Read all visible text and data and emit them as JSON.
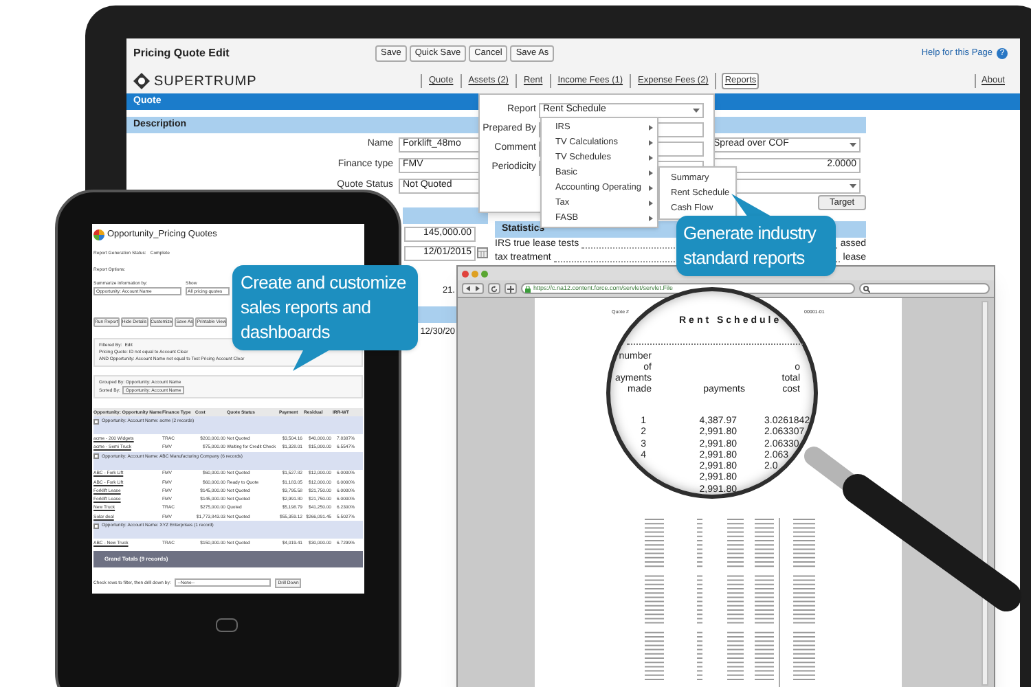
{
  "monitor": {
    "page_title": "Pricing Quote Edit",
    "toolbar_buttons": [
      "Save",
      "Quick Save",
      "Cancel",
      "Save As"
    ],
    "help_link": "Help for this Page",
    "help_icon": "?",
    "logo": "SUPERTRUMP",
    "nav_links": [
      {
        "label": "Quote",
        "selected": false
      },
      {
        "label": "Assets (2)",
        "selected": false
      },
      {
        "label": "Rent",
        "selected": false
      },
      {
        "label": "Income Fees (1)",
        "selected": false
      },
      {
        "label": "Expense Fees (2)",
        "selected": false
      },
      {
        "label": "Reports",
        "selected": true
      }
    ],
    "about_link": "About",
    "section_bar": "Quote",
    "description_bar": "Description",
    "form_fields": [
      {
        "label": "Name",
        "value": "Forklift_48mo"
      },
      {
        "label": "Finance type",
        "value": "FMV"
      },
      {
        "label": "Quote Status",
        "value": "Not Quoted"
      }
    ],
    "right_fields": [
      {
        "kind": "select",
        "value": "Spread over COF"
      },
      {
        "kind": "text",
        "value": "2.0000"
      },
      {
        "kind": "select"
      }
    ],
    "target_button": "Target",
    "lower_fields": [
      {
        "kind": "text",
        "value": "145,000.00"
      },
      {
        "kind": "date",
        "value": "12/01/2015"
      },
      {
        "kind": "gap"
      },
      {
        "kind": "partial",
        "value": "21."
      },
      {
        "kind": "section"
      },
      {
        "kind": "partial",
        "value": "12/30/20"
      }
    ],
    "statistics": {
      "title": "Statistics",
      "rows": [
        {
          "label": "IRS true lease tests",
          "value": "assed"
        },
        {
          "label": "tax treatment",
          "value": "lease"
        }
      ]
    },
    "report_popup": {
      "fields": [
        {
          "label": "Report",
          "kind": "select",
          "value": "Rent Schedule"
        },
        {
          "label": "Prepared By",
          "kind": "text"
        },
        {
          "label": "Comment",
          "kind": "text"
        },
        {
          "label": "Periodicity",
          "kind": "text"
        }
      ],
      "menu": [
        "IRS",
        "TV Calculations",
        "TV Schedules",
        "Basic",
        "Accounting Operating",
        "Tax",
        "FASB"
      ],
      "submenu": [
        "Summary",
        "Rent Schedule",
        "Cash Flow"
      ]
    }
  },
  "tablet": {
    "report_title": "Opportunity_Pricing Quotes",
    "status_label": "Report Generation Status:",
    "status_value": "Complete",
    "options_label": "Report Options:",
    "summarize_label": "Summarize information by:",
    "summarize_value": "Opportunity: Account Name",
    "show_label": "Show",
    "show_value": "All pricing quotes",
    "buttons": [
      "Run Report",
      "Hide Details",
      "Customize",
      "Save As",
      "Printable View"
    ],
    "filter_label": "Filtered By:",
    "filter_edit": "Edit",
    "filters": [
      "Pricing Quote: ID not equal to Account Clear",
      "AND Opportunity: Account Name not equal to Test Pricing Account Clear"
    ],
    "grouped_by": "Grouped By: Opportunity: Account Name",
    "sorted_by_label": "Sorted By:",
    "sorted_by_value": "Opportunity: Account Name",
    "columns": [
      "Opportunity: Opportunity Name",
      "Finance Type",
      "Cost",
      "Quote Status",
      "Payment",
      "Residual",
      "IRR-WT"
    ],
    "groups": [
      {
        "title": "Opportunity: Account Name: acme (2 records)",
        "checked": false,
        "rows": [
          [
            "acme - 200 Widgets",
            "TRAC",
            "$200,000.00",
            "Not Quoted",
            "$3,504.16",
            "$40,000.00",
            "7.8387%"
          ],
          [
            "acme - Semi Truck",
            "FMV",
            "$75,000.00",
            "Waiting for Credit Check",
            "$1,328.01",
            "$15,000.00",
            "6.5547%"
          ]
        ]
      },
      {
        "title": "Opportunity: Account Name: ABC Manufacturing Company (6 records)",
        "checked": false,
        "rows": [
          [
            "ABC - Fork Lift",
            "FMV",
            "$60,000.00",
            "Not Quoted",
            "$1,527.82",
            "$12,000.00",
            "6.0000%"
          ],
          [
            "ABC - Fork Lift",
            "FMV",
            "$60,000.00",
            "Ready to Quote",
            "$1,183.05",
            "$12,000.00",
            "6.0000%"
          ],
          [
            "Forklift Lease",
            "FMV",
            "$145,000.00",
            "Not Quoted",
            "$3,795.58",
            "$21,750.00",
            "6.0000%"
          ],
          [
            "Forklift Lease",
            "FMV",
            "$145,000.00",
            "Not Quoted",
            "$2,991.80",
            "$21,750.00",
            "6.0000%"
          ],
          [
            "New Truck",
            "TRAC",
            "$275,000.00",
            "Quoted",
            "$5,198.79",
            "$41,250.00",
            "6.2300%"
          ],
          [
            "Solar deal",
            "FMV",
            "$1,773,843.03",
            "Not Quoted",
            "$55,359.12",
            "$266,091.45",
            "5.5027%"
          ]
        ]
      },
      {
        "title": "Opportunity: Account Name: XYZ Enterprises (1 record)",
        "checked": false,
        "rows": [
          [
            "ABC - New Truck",
            "TRAC",
            "$150,000.00",
            "Not Quoted",
            "$4,019.41",
            "$30,000.00",
            "6.7299%"
          ]
        ]
      }
    ],
    "grand_totals": "Grand Totals (9 records)",
    "drill_label": "Check rows to filter, then drill down by:",
    "drill_value": "--None--",
    "drill_button": "Drill Down"
  },
  "browser": {
    "url": "https://c.na12.content.force.com/servlet/servlet.File",
    "document": {
      "quote_label": "Quote #",
      "quote_number": "00001-01",
      "title": "Rent Schedule",
      "headers": [
        [
          "number",
          "of",
          "ayments",
          "made"
        ],
        [
          "payments"
        ],
        [
          "o",
          "total",
          "cost"
        ]
      ],
      "rows": [
        {
          "number": "1",
          "payment": "4,387.97",
          "factor": "3.0261842"
        },
        {
          "number": "2",
          "payment": "2,991.80",
          "factor": "2.063307"
        },
        {
          "number": "3",
          "payment": "2,991.80",
          "factor": "2.06330"
        },
        {
          "number": "4",
          "payment": "2,991.80",
          "factor": "2.063"
        },
        {
          "payment": "2,991.80",
          "factor": "2.0"
        },
        {
          "payment": "2,991.80"
        },
        {
          "payment": "2,991.80"
        }
      ]
    }
  },
  "callouts": [
    {
      "text": "Create and customize sales reports and dashboards"
    },
    {
      "text": "Generate industry standard reports"
    }
  ]
}
